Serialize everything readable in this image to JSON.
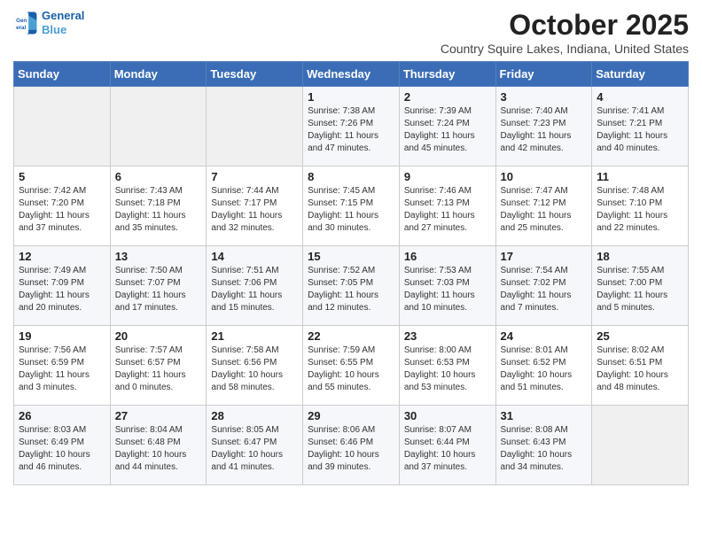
{
  "header": {
    "logo_line1": "General",
    "logo_line2": "Blue",
    "month": "October 2025",
    "location": "Country Squire Lakes, Indiana, United States"
  },
  "days_of_week": [
    "Sunday",
    "Monday",
    "Tuesday",
    "Wednesday",
    "Thursday",
    "Friday",
    "Saturday"
  ],
  "weeks": [
    [
      {
        "day": "",
        "info": ""
      },
      {
        "day": "",
        "info": ""
      },
      {
        "day": "",
        "info": ""
      },
      {
        "day": "1",
        "info": "Sunrise: 7:38 AM\nSunset: 7:26 PM\nDaylight: 11 hours and 47 minutes."
      },
      {
        "day": "2",
        "info": "Sunrise: 7:39 AM\nSunset: 7:24 PM\nDaylight: 11 hours and 45 minutes."
      },
      {
        "day": "3",
        "info": "Sunrise: 7:40 AM\nSunset: 7:23 PM\nDaylight: 11 hours and 42 minutes."
      },
      {
        "day": "4",
        "info": "Sunrise: 7:41 AM\nSunset: 7:21 PM\nDaylight: 11 hours and 40 minutes."
      }
    ],
    [
      {
        "day": "5",
        "info": "Sunrise: 7:42 AM\nSunset: 7:20 PM\nDaylight: 11 hours and 37 minutes."
      },
      {
        "day": "6",
        "info": "Sunrise: 7:43 AM\nSunset: 7:18 PM\nDaylight: 11 hours and 35 minutes."
      },
      {
        "day": "7",
        "info": "Sunrise: 7:44 AM\nSunset: 7:17 PM\nDaylight: 11 hours and 32 minutes."
      },
      {
        "day": "8",
        "info": "Sunrise: 7:45 AM\nSunset: 7:15 PM\nDaylight: 11 hours and 30 minutes."
      },
      {
        "day": "9",
        "info": "Sunrise: 7:46 AM\nSunset: 7:13 PM\nDaylight: 11 hours and 27 minutes."
      },
      {
        "day": "10",
        "info": "Sunrise: 7:47 AM\nSunset: 7:12 PM\nDaylight: 11 hours and 25 minutes."
      },
      {
        "day": "11",
        "info": "Sunrise: 7:48 AM\nSunset: 7:10 PM\nDaylight: 11 hours and 22 minutes."
      }
    ],
    [
      {
        "day": "12",
        "info": "Sunrise: 7:49 AM\nSunset: 7:09 PM\nDaylight: 11 hours and 20 minutes."
      },
      {
        "day": "13",
        "info": "Sunrise: 7:50 AM\nSunset: 7:07 PM\nDaylight: 11 hours and 17 minutes."
      },
      {
        "day": "14",
        "info": "Sunrise: 7:51 AM\nSunset: 7:06 PM\nDaylight: 11 hours and 15 minutes."
      },
      {
        "day": "15",
        "info": "Sunrise: 7:52 AM\nSunset: 7:05 PM\nDaylight: 11 hours and 12 minutes."
      },
      {
        "day": "16",
        "info": "Sunrise: 7:53 AM\nSunset: 7:03 PM\nDaylight: 11 hours and 10 minutes."
      },
      {
        "day": "17",
        "info": "Sunrise: 7:54 AM\nSunset: 7:02 PM\nDaylight: 11 hours and 7 minutes."
      },
      {
        "day": "18",
        "info": "Sunrise: 7:55 AM\nSunset: 7:00 PM\nDaylight: 11 hours and 5 minutes."
      }
    ],
    [
      {
        "day": "19",
        "info": "Sunrise: 7:56 AM\nSunset: 6:59 PM\nDaylight: 11 hours and 3 minutes."
      },
      {
        "day": "20",
        "info": "Sunrise: 7:57 AM\nSunset: 6:57 PM\nDaylight: 11 hours and 0 minutes."
      },
      {
        "day": "21",
        "info": "Sunrise: 7:58 AM\nSunset: 6:56 PM\nDaylight: 10 hours and 58 minutes."
      },
      {
        "day": "22",
        "info": "Sunrise: 7:59 AM\nSunset: 6:55 PM\nDaylight: 10 hours and 55 minutes."
      },
      {
        "day": "23",
        "info": "Sunrise: 8:00 AM\nSunset: 6:53 PM\nDaylight: 10 hours and 53 minutes."
      },
      {
        "day": "24",
        "info": "Sunrise: 8:01 AM\nSunset: 6:52 PM\nDaylight: 10 hours and 51 minutes."
      },
      {
        "day": "25",
        "info": "Sunrise: 8:02 AM\nSunset: 6:51 PM\nDaylight: 10 hours and 48 minutes."
      }
    ],
    [
      {
        "day": "26",
        "info": "Sunrise: 8:03 AM\nSunset: 6:49 PM\nDaylight: 10 hours and 46 minutes."
      },
      {
        "day": "27",
        "info": "Sunrise: 8:04 AM\nSunset: 6:48 PM\nDaylight: 10 hours and 44 minutes."
      },
      {
        "day": "28",
        "info": "Sunrise: 8:05 AM\nSunset: 6:47 PM\nDaylight: 10 hours and 41 minutes."
      },
      {
        "day": "29",
        "info": "Sunrise: 8:06 AM\nSunset: 6:46 PM\nDaylight: 10 hours and 39 minutes."
      },
      {
        "day": "30",
        "info": "Sunrise: 8:07 AM\nSunset: 6:44 PM\nDaylight: 10 hours and 37 minutes."
      },
      {
        "day": "31",
        "info": "Sunrise: 8:08 AM\nSunset: 6:43 PM\nDaylight: 10 hours and 34 minutes."
      },
      {
        "day": "",
        "info": ""
      }
    ]
  ]
}
